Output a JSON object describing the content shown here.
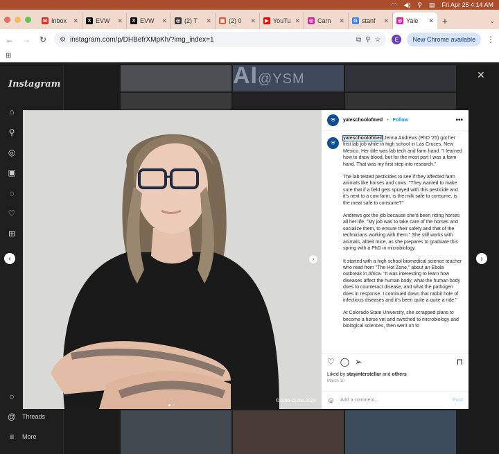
{
  "menubar": {
    "datetime": "Fri Apr 25  4:14 AM"
  },
  "tabs": [
    {
      "title": "Inbox",
      "icon": "gmail-icon",
      "color": "#d93025",
      "glyph": "M"
    },
    {
      "title": "EVW",
      "icon": "x-icon",
      "color": "#000000",
      "glyph": "X"
    },
    {
      "title": "EVW",
      "icon": "x-icon",
      "color": "#000000",
      "glyph": "X"
    },
    {
      "title": "(2) T",
      "icon": "site-icon",
      "color": "#333333",
      "glyph": "◎"
    },
    {
      "title": "(2) 0",
      "icon": "site-icon",
      "color": "#e8592b",
      "glyph": "▣"
    },
    {
      "title": "YouTu",
      "icon": "youtube-icon",
      "color": "#ff0000",
      "glyph": "▶"
    },
    {
      "title": "Carn",
      "icon": "instagram-icon",
      "color": "#d6249f",
      "glyph": "◎"
    },
    {
      "title": "stanf",
      "icon": "google-icon",
      "color": "#4285f4",
      "glyph": "G"
    },
    {
      "title": "Yale",
      "icon": "instagram-icon",
      "color": "#d6249f",
      "glyph": "◎"
    }
  ],
  "toolbar": {
    "url": "instagram.com/p/DHBefrXMpKh/?img_index=1",
    "profile_letter": "E",
    "update_label": "New Chrome available"
  },
  "instagram": {
    "logo": "Instagram",
    "sidebar_bottom": [
      {
        "label": "Threads"
      },
      {
        "label": "More"
      }
    ],
    "bg_text": "AI",
    "bg_handle": "@YSM"
  },
  "post": {
    "username": "yaleschoolofmed",
    "separator": "•",
    "follow_label": "Follow",
    "photo_credit": "©John Curtis 2024",
    "caption_intro": "Jenna Andrews (PhD '25) got her first lab job while in high school in Las Cruces, New Mexico. Her title was lab tech and farm hand. \"I learned how to draw blood, but for the most part I was a farm hand. That was my first step into research.\"",
    "caption_p2": "The lab tested pesticides to see if they affected farm animals like horses and cows. \"They wanted to make sure that if a field gets sprayed with this pesticide and it's next to a cow farm, is the milk safe to consume, is the meat safe to consume?\"",
    "caption_p3": "Andrews got the job because she'd been riding horses all her life. \"My job was to take care of the horses and socialize them, to ensure their safety and that of the technicians working with them.\" She still works with animals, albeit mice, as she prepares to graduate this spring with a PhD in microbiology.",
    "caption_p4": "It started with a high school biomedical science teacher who read from \"The Hot Zone,\" about an Ebola outbreak in Africa. \"It was interesting to learn how diseases affect the human body, what the human body does to counteract disease, and what the pathogen does in response. I continued down that rabbit hole of infectious diseases and it's been quite a quite a ride.\"",
    "caption_p5": "At Colorado State University, she scrapped plans to become a horse vet and switched to microbiology and biological sciences, then went on to",
    "likes_prefix": "Liked by ",
    "likes_user": "stayinterstellar",
    "likes_and": " and ",
    "likes_others": "others",
    "date": "March 10",
    "comment_placeholder": "Add a comment...",
    "post_label": "Post"
  }
}
